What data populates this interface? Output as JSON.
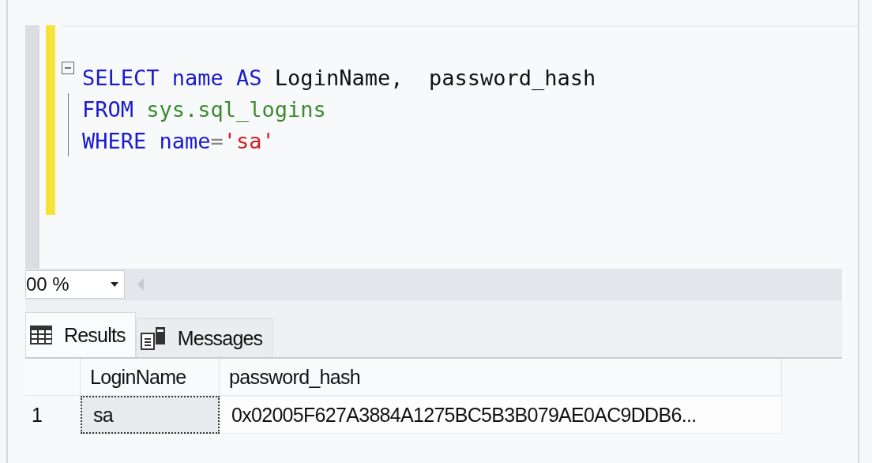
{
  "editor": {
    "fold_expanded": true,
    "lines": [
      {
        "tokens": [
          {
            "text": "SELECT ",
            "kind": "keyword"
          },
          {
            "text": "name ",
            "kind": "keyword"
          },
          {
            "text": "AS ",
            "kind": "keyword"
          },
          {
            "text": "LoginName,  password_hash",
            "kind": "plain"
          }
        ]
      },
      {
        "tokens": [
          {
            "text": "FROM ",
            "kind": "keyword"
          },
          {
            "text": "sys.sql_logins",
            "kind": "system"
          }
        ]
      },
      {
        "tokens": [
          {
            "text": "WHERE ",
            "kind": "keyword"
          },
          {
            "text": "name",
            "kind": "keyword"
          },
          {
            "text": "=",
            "kind": "operator"
          },
          {
            "text": "'sa'",
            "kind": "string"
          }
        ]
      }
    ]
  },
  "zoom": {
    "value": "00 %"
  },
  "tabs": [
    {
      "label": "Results",
      "selected": true,
      "kind": "grid"
    },
    {
      "label": "Messages",
      "selected": false,
      "kind": "messages"
    }
  ],
  "table": {
    "columns": [
      "LoginName",
      "password_hash"
    ],
    "rows": [
      {
        "number": "1",
        "cells": [
          {
            "text": "sa",
            "selected": true
          },
          {
            "text": "0x02005F627A3884A1275BC5B3B079AE0AC9DDB6...",
            "selected": false
          }
        ]
      }
    ]
  }
}
